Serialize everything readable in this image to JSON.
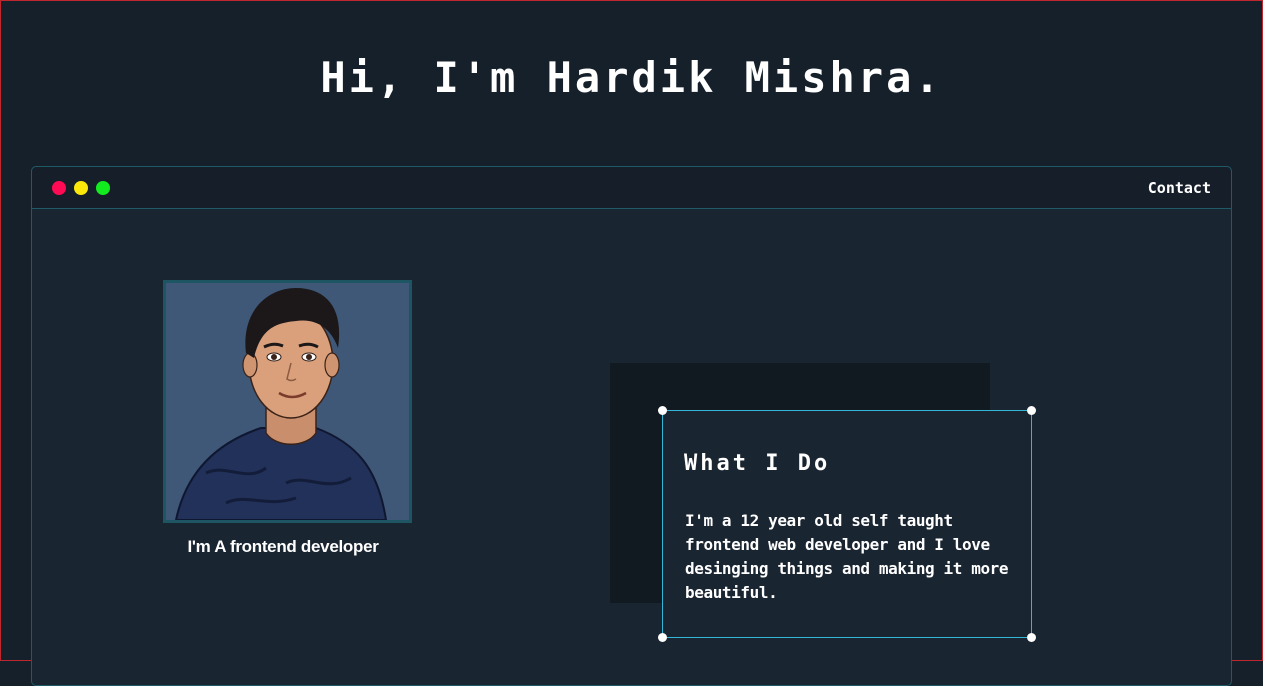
{
  "header": {
    "title": "Hi, I'm Hardik Mishra."
  },
  "window": {
    "controls": [
      "red-dot",
      "yellow-dot",
      "green-dot"
    ],
    "nav": {
      "contact_label": "Contact"
    }
  },
  "profile": {
    "image_alt": "avatar illustration",
    "caption": "I'm A frontend developer"
  },
  "what_i_do": {
    "title": "What I Do",
    "text": "I'm a 12 year old self taught frontend web developer and I love desinging things and making it more beautiful."
  },
  "colors": {
    "background": "#16202b",
    "window_border": "#1f5a66",
    "card_border": "#33b6d8",
    "dot_red": "#ff0a54",
    "dot_yellow": "#fbe80a",
    "dot_green": "#12ec1f"
  }
}
